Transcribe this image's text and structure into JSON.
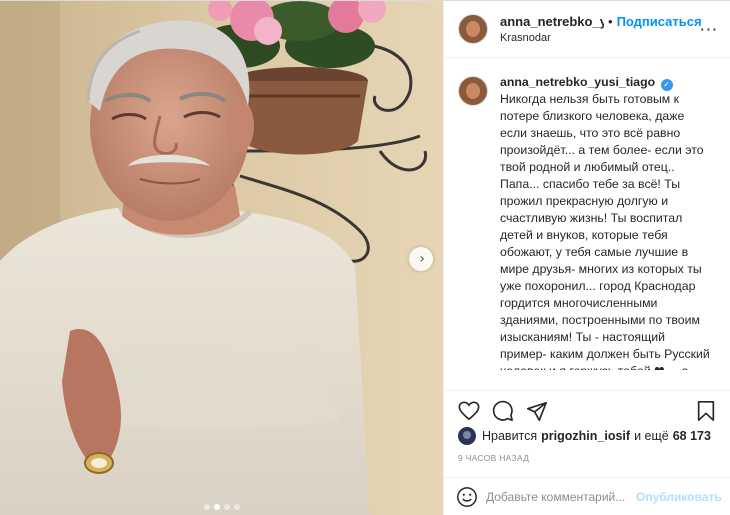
{
  "post": {
    "username_header": "anna_netrebko_yus",
    "separator": "•",
    "follow_label": "Подписаться",
    "location": "Krasnodar",
    "more_label": "···"
  },
  "caption": {
    "username": "anna_netrebko_yusi_tiago",
    "verified_glyph": "✓",
    "text": "Никогда нельзя быть готовым к потере близкого человека, даже если знаешь, что это всё равно произойдёт... а тем более- если это твой родной и любимый отец..​​ Папа... спасибо тебе за всё! Ты прожил прекрасную долгую и счастливую жизнь! Ты воспитал детей и внуков, которые тебя обожают, у тебя самые лучшие в мире друзья- многих из которых ты уже похоронил... город Краснодар гордится многочисленными зданиями, построенными по твоим изысканиям! Ты - настоящий пример- каким должен быть Русский человек и я горжусь тобой ❤​​ ... а ещё- ты «везунчик «-"
  },
  "actions": {
    "like_icon": "heart-icon",
    "comment_icon": "comment-icon",
    "share_icon": "share-icon",
    "save_icon": "bookmark-icon"
  },
  "likes": {
    "prefix": "Нравится",
    "user": "prigozhin_iosif",
    "middle": "и ещё",
    "count": "68 173"
  },
  "timestamp": "9 часов назад",
  "comment": {
    "placeholder": "Добавьте комментарий...",
    "publish_label": "Опубликовать"
  },
  "carousel": {
    "next_glyph": "›",
    "dots": 4,
    "active_dot": 1
  },
  "colors": {
    "link": "#0095f6",
    "publish_disabled": "#b2dffc",
    "muted": "#8e8e8e",
    "verified": "#3897f0"
  }
}
